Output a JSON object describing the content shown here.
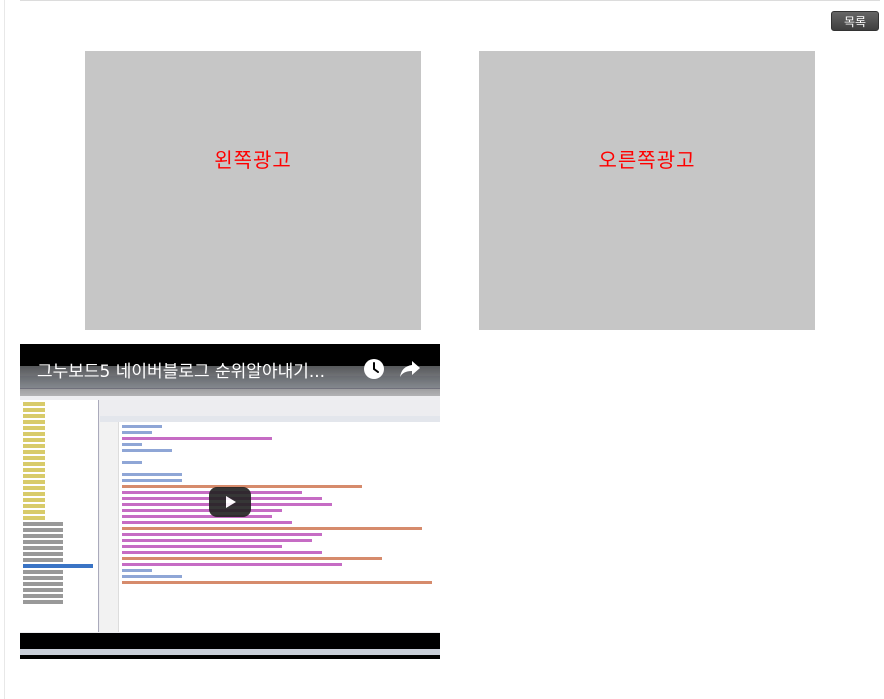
{
  "toolbar": {
    "list_label": "목록"
  },
  "ads": {
    "left_label": "왼쪽광고",
    "right_label": "오른쪽광고"
  },
  "video": {
    "title": "그누보드5 네이버블로그 순위알아내기...",
    "icons": [
      "clock-icon",
      "share-icon",
      "play-icon"
    ]
  },
  "colors": {
    "ad_background": "#c6c6c6",
    "ad_text": "#ff0000",
    "button_background": "#4a4a4a"
  }
}
